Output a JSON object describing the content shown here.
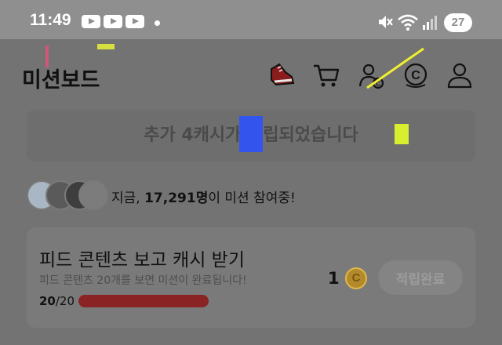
{
  "status_bar": {
    "time": "11:49",
    "battery": "27",
    "icons": [
      "youtube-icon",
      "youtube-icon",
      "youtube-icon",
      "notification-dot-icon",
      "mute-icon",
      "wifi-icon",
      "signal-icon",
      "battery-icon"
    ]
  },
  "header": {
    "title": "미션보드",
    "icons": [
      "sneaker-icon",
      "cart-icon",
      "friends-icon",
      "cash-icon",
      "profile-icon"
    ]
  },
  "banner": {
    "text": "추가 4캐시가 적립되었습니다"
  },
  "participants": {
    "prefix": "지금, ",
    "count": "17,291명",
    "suffix": "이 미션 참여중!"
  },
  "mission": {
    "title": "피드 콘텐츠 보고 캐시 받기",
    "description": "피드 콘텐츠 20개를 보면 미션이 완료됩니다!",
    "progress_current": "20",
    "progress_total": "/20",
    "progress_fraction": 1.0,
    "reward": "1",
    "status_button": "적립완료"
  },
  "colors": {
    "overlay_background": "#737373",
    "status_bar": "#8f8f8f",
    "progress_fill": "#8a2323",
    "coin": "#b38a2a"
  }
}
